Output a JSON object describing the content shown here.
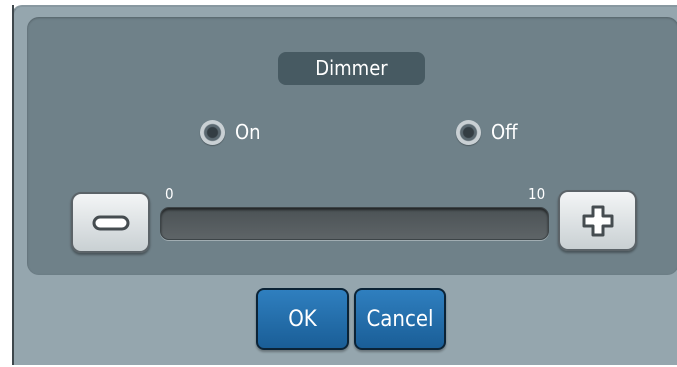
{
  "dialog": {
    "title": "Dimmer",
    "power_options": [
      {
        "label": "On"
      },
      {
        "label": "Off"
      }
    ],
    "slider": {
      "min_label": "0",
      "max_label": "10",
      "min": 0,
      "max": 10,
      "value": 0
    },
    "buttons": {
      "ok_label": "OK",
      "cancel_label": "Cancel"
    },
    "icons": {
      "decrease": "minus-icon",
      "increase": "plus-icon"
    },
    "colors": {
      "accent": "#1f6aa8",
      "panel": "#6f8189",
      "dialog_bg": "#95a6ae"
    }
  }
}
